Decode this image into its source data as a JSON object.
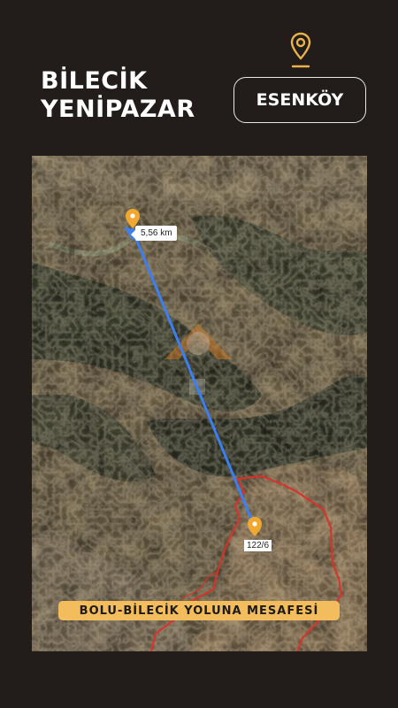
{
  "header": {
    "title_line1": "BİLECİK",
    "title_line2": "YENİPAZAR",
    "place_button": "ESENKÖY",
    "location_icon": "map-pin-icon"
  },
  "map": {
    "distance_label": "5,56 km",
    "parcel_label": "122/6",
    "banner_text": "BOLU-BİLECİK YOLUNA MESAFESİ",
    "watermark_icon": "logo-watermark",
    "colors": {
      "accent": "#f3bd5e",
      "route_line": "#3b7ff0",
      "boundary": "#d8332a",
      "pin": "#f0a830"
    }
  }
}
